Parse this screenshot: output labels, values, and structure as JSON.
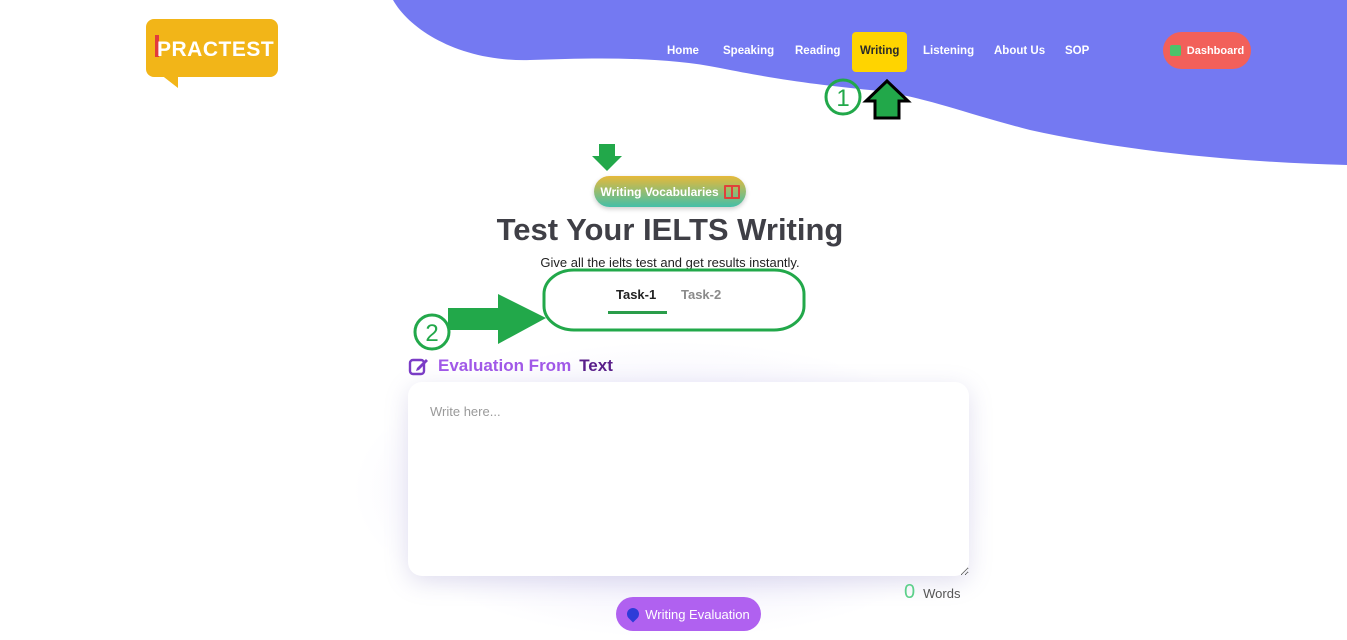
{
  "brand": {
    "logo_text": "PRACTEST"
  },
  "nav": {
    "items": [
      {
        "label": "Home"
      },
      {
        "label": "Speaking"
      },
      {
        "label": "Reading"
      },
      {
        "label": "Writing"
      },
      {
        "label": "Listening"
      },
      {
        "label": "About Us"
      },
      {
        "label": "SOP"
      }
    ],
    "active": "Writing",
    "dashboard_label": "Dashboard"
  },
  "hero": {
    "vocab_button": "Writing Vocabularies",
    "title": "Test Your IELTS Writing",
    "subtitle": "Give all the ielts test and get results instantly."
  },
  "tabs": [
    {
      "label": "Task-1",
      "active": true
    },
    {
      "label": "Task-2",
      "active": false
    }
  ],
  "section": {
    "title_part1": "Evaluation From",
    "title_part2": "Text"
  },
  "editor": {
    "placeholder": "Write here...",
    "value": ""
  },
  "word_count": {
    "value": "0",
    "label": "Words"
  },
  "evaluate_button": "Writing Evaluation",
  "annotations": {
    "marker_1": "1",
    "marker_2": "2"
  },
  "colors": {
    "wave": "#7479f2",
    "active_nav": "#ffd400",
    "dashboard": "#f2605a",
    "annotation_green": "#22a84a",
    "evaluate": "#b061f0"
  }
}
